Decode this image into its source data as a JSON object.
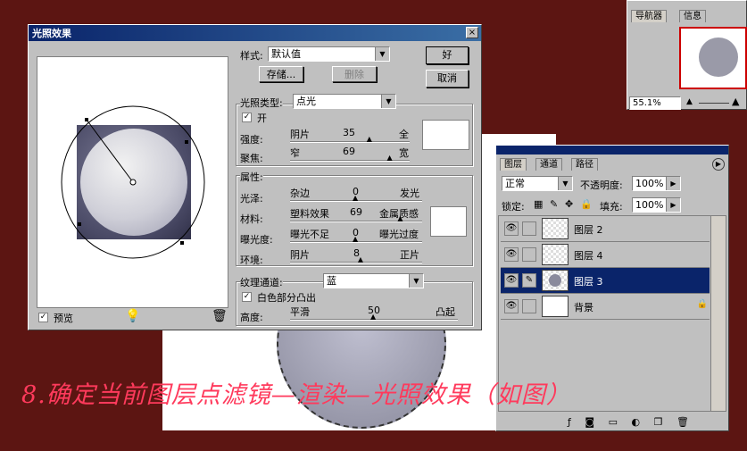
{
  "colors": {
    "background": "#5c1512",
    "titlebar": "#0a246a",
    "caption": "#ff3a5c",
    "selection": "#0a246a"
  },
  "navigator": {
    "tabs": [
      "导航器",
      "信息"
    ],
    "zoom": "55.1%"
  },
  "dialog": {
    "title": "光照效果",
    "close_label": "×",
    "preview_label": "预览",
    "style_label": "样式:",
    "style_value": "默认值",
    "save_label": "存储...",
    "delete_label": "删除",
    "ok_label": "好",
    "cancel_label": "取消",
    "light_type_label": "光照类型:",
    "light_type_value": "点光",
    "on_label": "开",
    "intensity": {
      "label": "强度:",
      "left": "阴片",
      "value": "35",
      "right": "全",
      "fraction": 0.67
    },
    "focus": {
      "label": "聚焦:",
      "left": "窄",
      "value": "69",
      "right": "宽",
      "fraction": 0.84
    },
    "properties_label": "属性:",
    "gloss": {
      "label": "光泽:",
      "left": "杂边",
      "value": "0",
      "right": "发光",
      "fraction": 0.5
    },
    "material": {
      "label": "材料:",
      "left": "塑料效果",
      "value": "69",
      "right": "金属质感",
      "fraction": 0.84
    },
    "exposure": {
      "label": "曝光度:",
      "left": "曝光不足",
      "value": "0",
      "right": "曝光过度",
      "fraction": 0.5
    },
    "ambience": {
      "label": "环境:",
      "left": "阴片",
      "value": "8",
      "right": "正片",
      "fraction": 0.54
    },
    "texture_label": "纹理通道:",
    "texture_value": "蓝",
    "white_high_label": "白色部分凸出",
    "height": {
      "label": "高度:",
      "left": "平滑",
      "value": "50",
      "right": "凸起",
      "fraction": 0.5
    }
  },
  "layers": {
    "tabs": [
      "图层",
      "通道",
      "路径"
    ],
    "blend_mode": "正常",
    "opacity_label": "不透明度:",
    "opacity_value": "100%",
    "lock_label": "锁定:",
    "fill_label": "填充:",
    "fill_value": "100%",
    "items": [
      {
        "name": "图层 2",
        "selected": false
      },
      {
        "name": "图层 4",
        "selected": false
      },
      {
        "name": "图层 3",
        "selected": true
      },
      {
        "name": "背景",
        "selected": false
      }
    ]
  },
  "caption": "8.确定当前图层点滤镜—渲染—光照效果（如图）"
}
